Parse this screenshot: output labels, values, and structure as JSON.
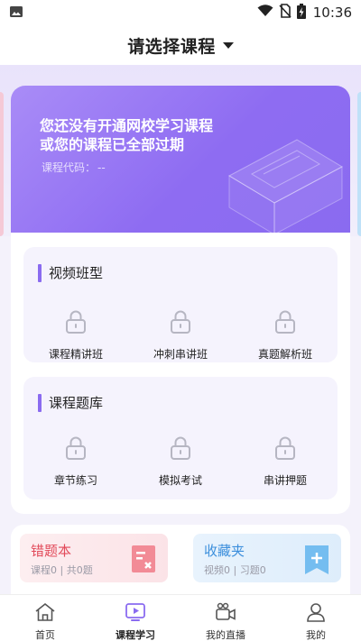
{
  "status_bar": {
    "time": "10:36",
    "icons": [
      "image-icon",
      "wifi-icon",
      "no-sim-icon",
      "battery-charging-icon"
    ]
  },
  "header": {
    "title": "请选择课程"
  },
  "banner": {
    "title_line1": "您还没有开通网校学习课程",
    "title_line2": "或您的课程已全部过期",
    "code_label": "课程代码：",
    "code_value": "--"
  },
  "video_section": {
    "title": "视频班型",
    "items": [
      {
        "label": "课程精讲班",
        "icon": "lock-icon"
      },
      {
        "label": "冲刺串讲班",
        "icon": "lock-icon"
      },
      {
        "label": "真题解析班",
        "icon": "lock-icon"
      }
    ]
  },
  "bank_section": {
    "title": "课程题库",
    "items": [
      {
        "label": "章节练习",
        "icon": "lock-icon"
      },
      {
        "label": "模拟考试",
        "icon": "lock-icon"
      },
      {
        "label": "串讲押题",
        "icon": "lock-icon"
      }
    ]
  },
  "tools": {
    "wrong_book": {
      "title": "错题本",
      "sub": "课程0 | 共0题"
    },
    "favorites": {
      "title": "收藏夹",
      "sub": "视频0 | 习题0"
    }
  },
  "bottom_nav": [
    {
      "label": "首页",
      "icon": "home-icon"
    },
    {
      "label": "课程学习",
      "icon": "play-icon",
      "active": true
    },
    {
      "label": "我的直播",
      "icon": "video-camera-icon"
    },
    {
      "label": "我的",
      "icon": "user-icon"
    }
  ],
  "colors": {
    "accent": "#8a6bf0",
    "wrong": "#e24a5a",
    "fav": "#3c8fdc"
  }
}
